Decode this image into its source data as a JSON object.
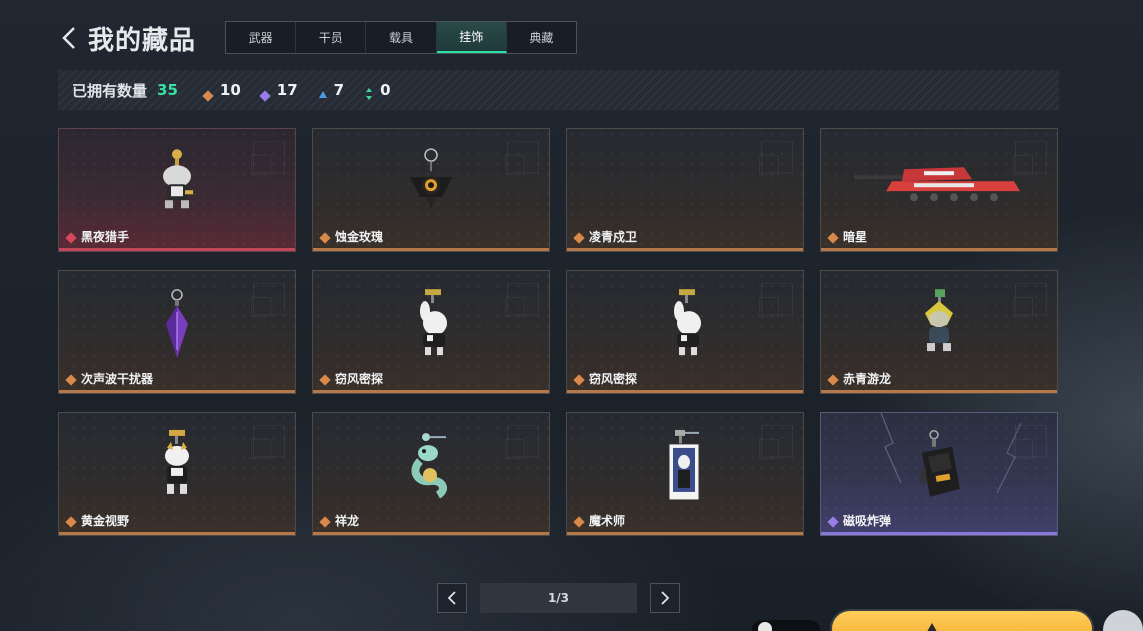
{
  "header": {
    "title": "我的藏品",
    "tabs": [
      {
        "label": "武器",
        "active": false
      },
      {
        "label": "干员",
        "active": false
      },
      {
        "label": "载具",
        "active": false
      },
      {
        "label": "挂饰",
        "active": true
      },
      {
        "label": "典藏",
        "active": false
      }
    ]
  },
  "stats": {
    "owned_label": "已拥有数量",
    "owned_total": "35",
    "rarity_counts": [
      {
        "icon": "orange-diamond-icon",
        "color": "#d9894a",
        "count": "10"
      },
      {
        "icon": "purple-diamond-icon",
        "color": "#9a7be8",
        "count": "17"
      },
      {
        "icon": "blue-triangle-icon",
        "color": "#4d9be0",
        "count": "7"
      },
      {
        "icon": "green-arrow-icon",
        "color": "#3fd79a",
        "count": "0"
      }
    ]
  },
  "items": [
    {
      "name": "黑夜猎手",
      "rarity": "red",
      "rarity_color": "#d8475c",
      "icon": "figure-charm-icon"
    },
    {
      "name": "蚀金玫瑰",
      "rarity": "orange",
      "rarity_color": "#d9894a",
      "icon": "rose-charm-icon"
    },
    {
      "name": "凌青戍卫",
      "rarity": "orange",
      "rarity_color": "#d9894a",
      "icon": "empty-charm-icon"
    },
    {
      "name": "暗星",
      "rarity": "orange",
      "rarity_color": "#d9894a",
      "icon": "tank-icon"
    },
    {
      "name": "次声波干扰器",
      "rarity": "orange",
      "rarity_color": "#d9894a",
      "icon": "crystal-charm-icon"
    },
    {
      "name": "窃风密探",
      "rarity": "orange",
      "rarity_color": "#d9894a",
      "icon": "rabbit-charm-icon"
    },
    {
      "name": "窃风密探",
      "rarity": "orange",
      "rarity_color": "#d9894a",
      "icon": "rabbit-charm-icon"
    },
    {
      "name": "赤青游龙",
      "rarity": "orange",
      "rarity_color": "#d9894a",
      "icon": "figure-charm-icon"
    },
    {
      "name": "黄金视野",
      "rarity": "orange",
      "rarity_color": "#d9894a",
      "icon": "figure-charm-icon"
    },
    {
      "name": "祥龙",
      "rarity": "orange",
      "rarity_color": "#d9894a",
      "icon": "dragon-charm-icon"
    },
    {
      "name": "魔术师",
      "rarity": "orange",
      "rarity_color": "#d9894a",
      "icon": "card-charm-icon"
    },
    {
      "name": "磁吸炸弹",
      "rarity": "purple",
      "rarity_color": "#9a7be8",
      "icon": "bomb-charm-icon"
    }
  ],
  "pagination": {
    "current": "1/3"
  }
}
